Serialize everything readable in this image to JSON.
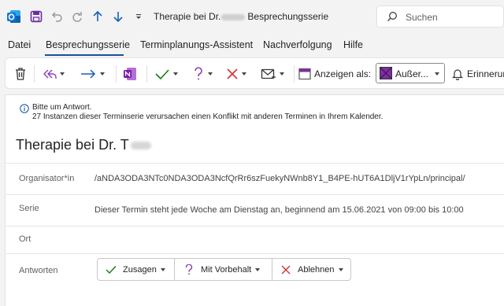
{
  "titlebar": {
    "title_prefix": "Therapie bei Dr.",
    "title_suffix": "Besprechungsserie",
    "icons": [
      "outlook-app-icon",
      "save-icon",
      "undo-icon",
      "redo-icon",
      "up-arrow-icon",
      "down-arrow-icon",
      "quick-access-more-icon"
    ]
  },
  "search": {
    "placeholder": "Suchen"
  },
  "menu": {
    "items": [
      "Datei",
      "Besprechungsserie",
      "Terminplanungs-Assistent",
      "Nachverfolgung",
      "Hilfe"
    ],
    "active": "Besprechungsserie"
  },
  "ribbon": {
    "show_as_label": "Anzeigen als:",
    "show_as_value": "Außer...",
    "remind_label": "Erinnerun",
    "icons": [
      "delete-icon",
      "reply-all-icon",
      "forward-icon",
      "onenote-icon",
      "accept-icon",
      "tentative-icon",
      "decline-icon",
      "respond-mail-icon",
      "show-as-icon"
    ]
  },
  "info": {
    "line1": "Bitte um Antwort.",
    "line2": "27 Instanzen dieser Terminserie verursachen einen Konflikt mit anderen Terminen in Ihrem Kalender."
  },
  "subject": "Therapie bei Dr. T",
  "fields": {
    "organizer_label": "Organisator*in",
    "organizer_value": "/aNDA3ODA3NTc0NDA3ODA3NcfQrRr6szFuekyNWnb8Y1_B4PE-hUT6A1DljV1rYpLn/principal/",
    "series_label": "Serie",
    "series_value": "Dieser Termin steht jede Woche am Dienstag an, beginnend am 15.06.2021 von 09:00 bis 10:00",
    "location_label": "Ort",
    "location_value": "",
    "responses_label": "Antworten"
  },
  "responses": {
    "accept": "Zusagen",
    "tentative": "Mit Vorbehalt",
    "decline": "Ablehnen"
  },
  "colors": {
    "accent": "#1a4fa0",
    "accept_green": "#107c10",
    "tentative_purple": "#8a3fb0",
    "decline_red": "#d13438",
    "onenote_purple": "#7719aa",
    "save_purple": "#6b2fa0"
  }
}
